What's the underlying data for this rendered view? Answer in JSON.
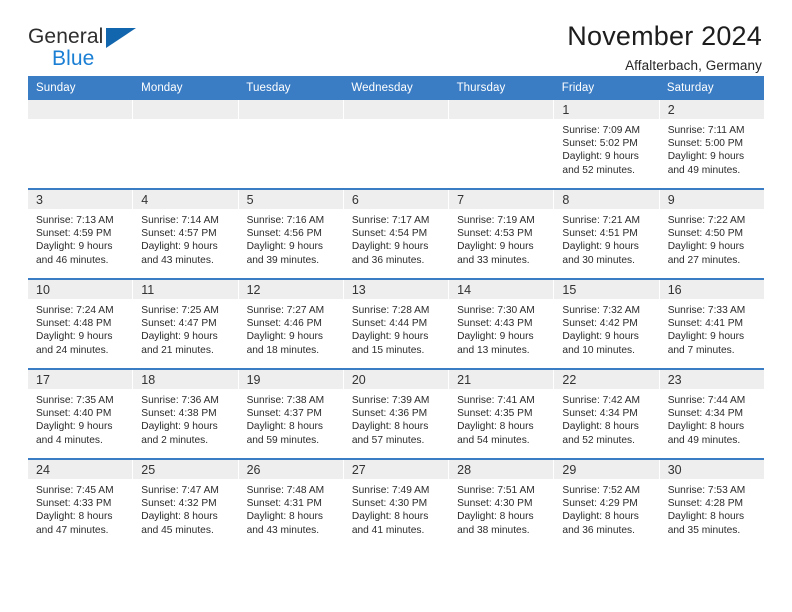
{
  "brand": {
    "name_part1": "General",
    "name_part2": "Blue",
    "triangle_color": "#1266ad",
    "blue_text_color": "#1b7fd4"
  },
  "header": {
    "title": "November 2024",
    "subtitle": "Affalterbach, Germany"
  },
  "theme": {
    "header_bar_color": "#3b7dc4",
    "day_band_color": "#eeeeee",
    "text_color": "#2b2b2b"
  },
  "weekdays": [
    "Sunday",
    "Monday",
    "Tuesday",
    "Wednesday",
    "Thursday",
    "Friday",
    "Saturday"
  ],
  "weeks": [
    [
      {
        "empty": true
      },
      {
        "empty": true
      },
      {
        "empty": true
      },
      {
        "empty": true
      },
      {
        "empty": true
      },
      {
        "day": "1",
        "sunrise": "Sunrise: 7:09 AM",
        "sunset": "Sunset: 5:02 PM",
        "daylight_line1": "Daylight: 9 hours",
        "daylight_line2": "and 52 minutes."
      },
      {
        "day": "2",
        "sunrise": "Sunrise: 7:11 AM",
        "sunset": "Sunset: 5:00 PM",
        "daylight_line1": "Daylight: 9 hours",
        "daylight_line2": "and 49 minutes."
      }
    ],
    [
      {
        "day": "3",
        "sunrise": "Sunrise: 7:13 AM",
        "sunset": "Sunset: 4:59 PM",
        "daylight_line1": "Daylight: 9 hours",
        "daylight_line2": "and 46 minutes."
      },
      {
        "day": "4",
        "sunrise": "Sunrise: 7:14 AM",
        "sunset": "Sunset: 4:57 PM",
        "daylight_line1": "Daylight: 9 hours",
        "daylight_line2": "and 43 minutes."
      },
      {
        "day": "5",
        "sunrise": "Sunrise: 7:16 AM",
        "sunset": "Sunset: 4:56 PM",
        "daylight_line1": "Daylight: 9 hours",
        "daylight_line2": "and 39 minutes."
      },
      {
        "day": "6",
        "sunrise": "Sunrise: 7:17 AM",
        "sunset": "Sunset: 4:54 PM",
        "daylight_line1": "Daylight: 9 hours",
        "daylight_line2": "and 36 minutes."
      },
      {
        "day": "7",
        "sunrise": "Sunrise: 7:19 AM",
        "sunset": "Sunset: 4:53 PM",
        "daylight_line1": "Daylight: 9 hours",
        "daylight_line2": "and 33 minutes."
      },
      {
        "day": "8",
        "sunrise": "Sunrise: 7:21 AM",
        "sunset": "Sunset: 4:51 PM",
        "daylight_line1": "Daylight: 9 hours",
        "daylight_line2": "and 30 minutes."
      },
      {
        "day": "9",
        "sunrise": "Sunrise: 7:22 AM",
        "sunset": "Sunset: 4:50 PM",
        "daylight_line1": "Daylight: 9 hours",
        "daylight_line2": "and 27 minutes."
      }
    ],
    [
      {
        "day": "10",
        "sunrise": "Sunrise: 7:24 AM",
        "sunset": "Sunset: 4:48 PM",
        "daylight_line1": "Daylight: 9 hours",
        "daylight_line2": "and 24 minutes."
      },
      {
        "day": "11",
        "sunrise": "Sunrise: 7:25 AM",
        "sunset": "Sunset: 4:47 PM",
        "daylight_line1": "Daylight: 9 hours",
        "daylight_line2": "and 21 minutes."
      },
      {
        "day": "12",
        "sunrise": "Sunrise: 7:27 AM",
        "sunset": "Sunset: 4:46 PM",
        "daylight_line1": "Daylight: 9 hours",
        "daylight_line2": "and 18 minutes."
      },
      {
        "day": "13",
        "sunrise": "Sunrise: 7:28 AM",
        "sunset": "Sunset: 4:44 PM",
        "daylight_line1": "Daylight: 9 hours",
        "daylight_line2": "and 15 minutes."
      },
      {
        "day": "14",
        "sunrise": "Sunrise: 7:30 AM",
        "sunset": "Sunset: 4:43 PM",
        "daylight_line1": "Daylight: 9 hours",
        "daylight_line2": "and 13 minutes."
      },
      {
        "day": "15",
        "sunrise": "Sunrise: 7:32 AM",
        "sunset": "Sunset: 4:42 PM",
        "daylight_line1": "Daylight: 9 hours",
        "daylight_line2": "and 10 minutes."
      },
      {
        "day": "16",
        "sunrise": "Sunrise: 7:33 AM",
        "sunset": "Sunset: 4:41 PM",
        "daylight_line1": "Daylight: 9 hours",
        "daylight_line2": "and 7 minutes."
      }
    ],
    [
      {
        "day": "17",
        "sunrise": "Sunrise: 7:35 AM",
        "sunset": "Sunset: 4:40 PM",
        "daylight_line1": "Daylight: 9 hours",
        "daylight_line2": "and 4 minutes."
      },
      {
        "day": "18",
        "sunrise": "Sunrise: 7:36 AM",
        "sunset": "Sunset: 4:38 PM",
        "daylight_line1": "Daylight: 9 hours",
        "daylight_line2": "and 2 minutes."
      },
      {
        "day": "19",
        "sunrise": "Sunrise: 7:38 AM",
        "sunset": "Sunset: 4:37 PM",
        "daylight_line1": "Daylight: 8 hours",
        "daylight_line2": "and 59 minutes."
      },
      {
        "day": "20",
        "sunrise": "Sunrise: 7:39 AM",
        "sunset": "Sunset: 4:36 PM",
        "daylight_line1": "Daylight: 8 hours",
        "daylight_line2": "and 57 minutes."
      },
      {
        "day": "21",
        "sunrise": "Sunrise: 7:41 AM",
        "sunset": "Sunset: 4:35 PM",
        "daylight_line1": "Daylight: 8 hours",
        "daylight_line2": "and 54 minutes."
      },
      {
        "day": "22",
        "sunrise": "Sunrise: 7:42 AM",
        "sunset": "Sunset: 4:34 PM",
        "daylight_line1": "Daylight: 8 hours",
        "daylight_line2": "and 52 minutes."
      },
      {
        "day": "23",
        "sunrise": "Sunrise: 7:44 AM",
        "sunset": "Sunset: 4:34 PM",
        "daylight_line1": "Daylight: 8 hours",
        "daylight_line2": "and 49 minutes."
      }
    ],
    [
      {
        "day": "24",
        "sunrise": "Sunrise: 7:45 AM",
        "sunset": "Sunset: 4:33 PM",
        "daylight_line1": "Daylight: 8 hours",
        "daylight_line2": "and 47 minutes."
      },
      {
        "day": "25",
        "sunrise": "Sunrise: 7:47 AM",
        "sunset": "Sunset: 4:32 PM",
        "daylight_line1": "Daylight: 8 hours",
        "daylight_line2": "and 45 minutes."
      },
      {
        "day": "26",
        "sunrise": "Sunrise: 7:48 AM",
        "sunset": "Sunset: 4:31 PM",
        "daylight_line1": "Daylight: 8 hours",
        "daylight_line2": "and 43 minutes."
      },
      {
        "day": "27",
        "sunrise": "Sunrise: 7:49 AM",
        "sunset": "Sunset: 4:30 PM",
        "daylight_line1": "Daylight: 8 hours",
        "daylight_line2": "and 41 minutes."
      },
      {
        "day": "28",
        "sunrise": "Sunrise: 7:51 AM",
        "sunset": "Sunset: 4:30 PM",
        "daylight_line1": "Daylight: 8 hours",
        "daylight_line2": "and 38 minutes."
      },
      {
        "day": "29",
        "sunrise": "Sunrise: 7:52 AM",
        "sunset": "Sunset: 4:29 PM",
        "daylight_line1": "Daylight: 8 hours",
        "daylight_line2": "and 36 minutes."
      },
      {
        "day": "30",
        "sunrise": "Sunrise: 7:53 AM",
        "sunset": "Sunset: 4:28 PM",
        "daylight_line1": "Daylight: 8 hours",
        "daylight_line2": "and 35 minutes."
      }
    ]
  ]
}
